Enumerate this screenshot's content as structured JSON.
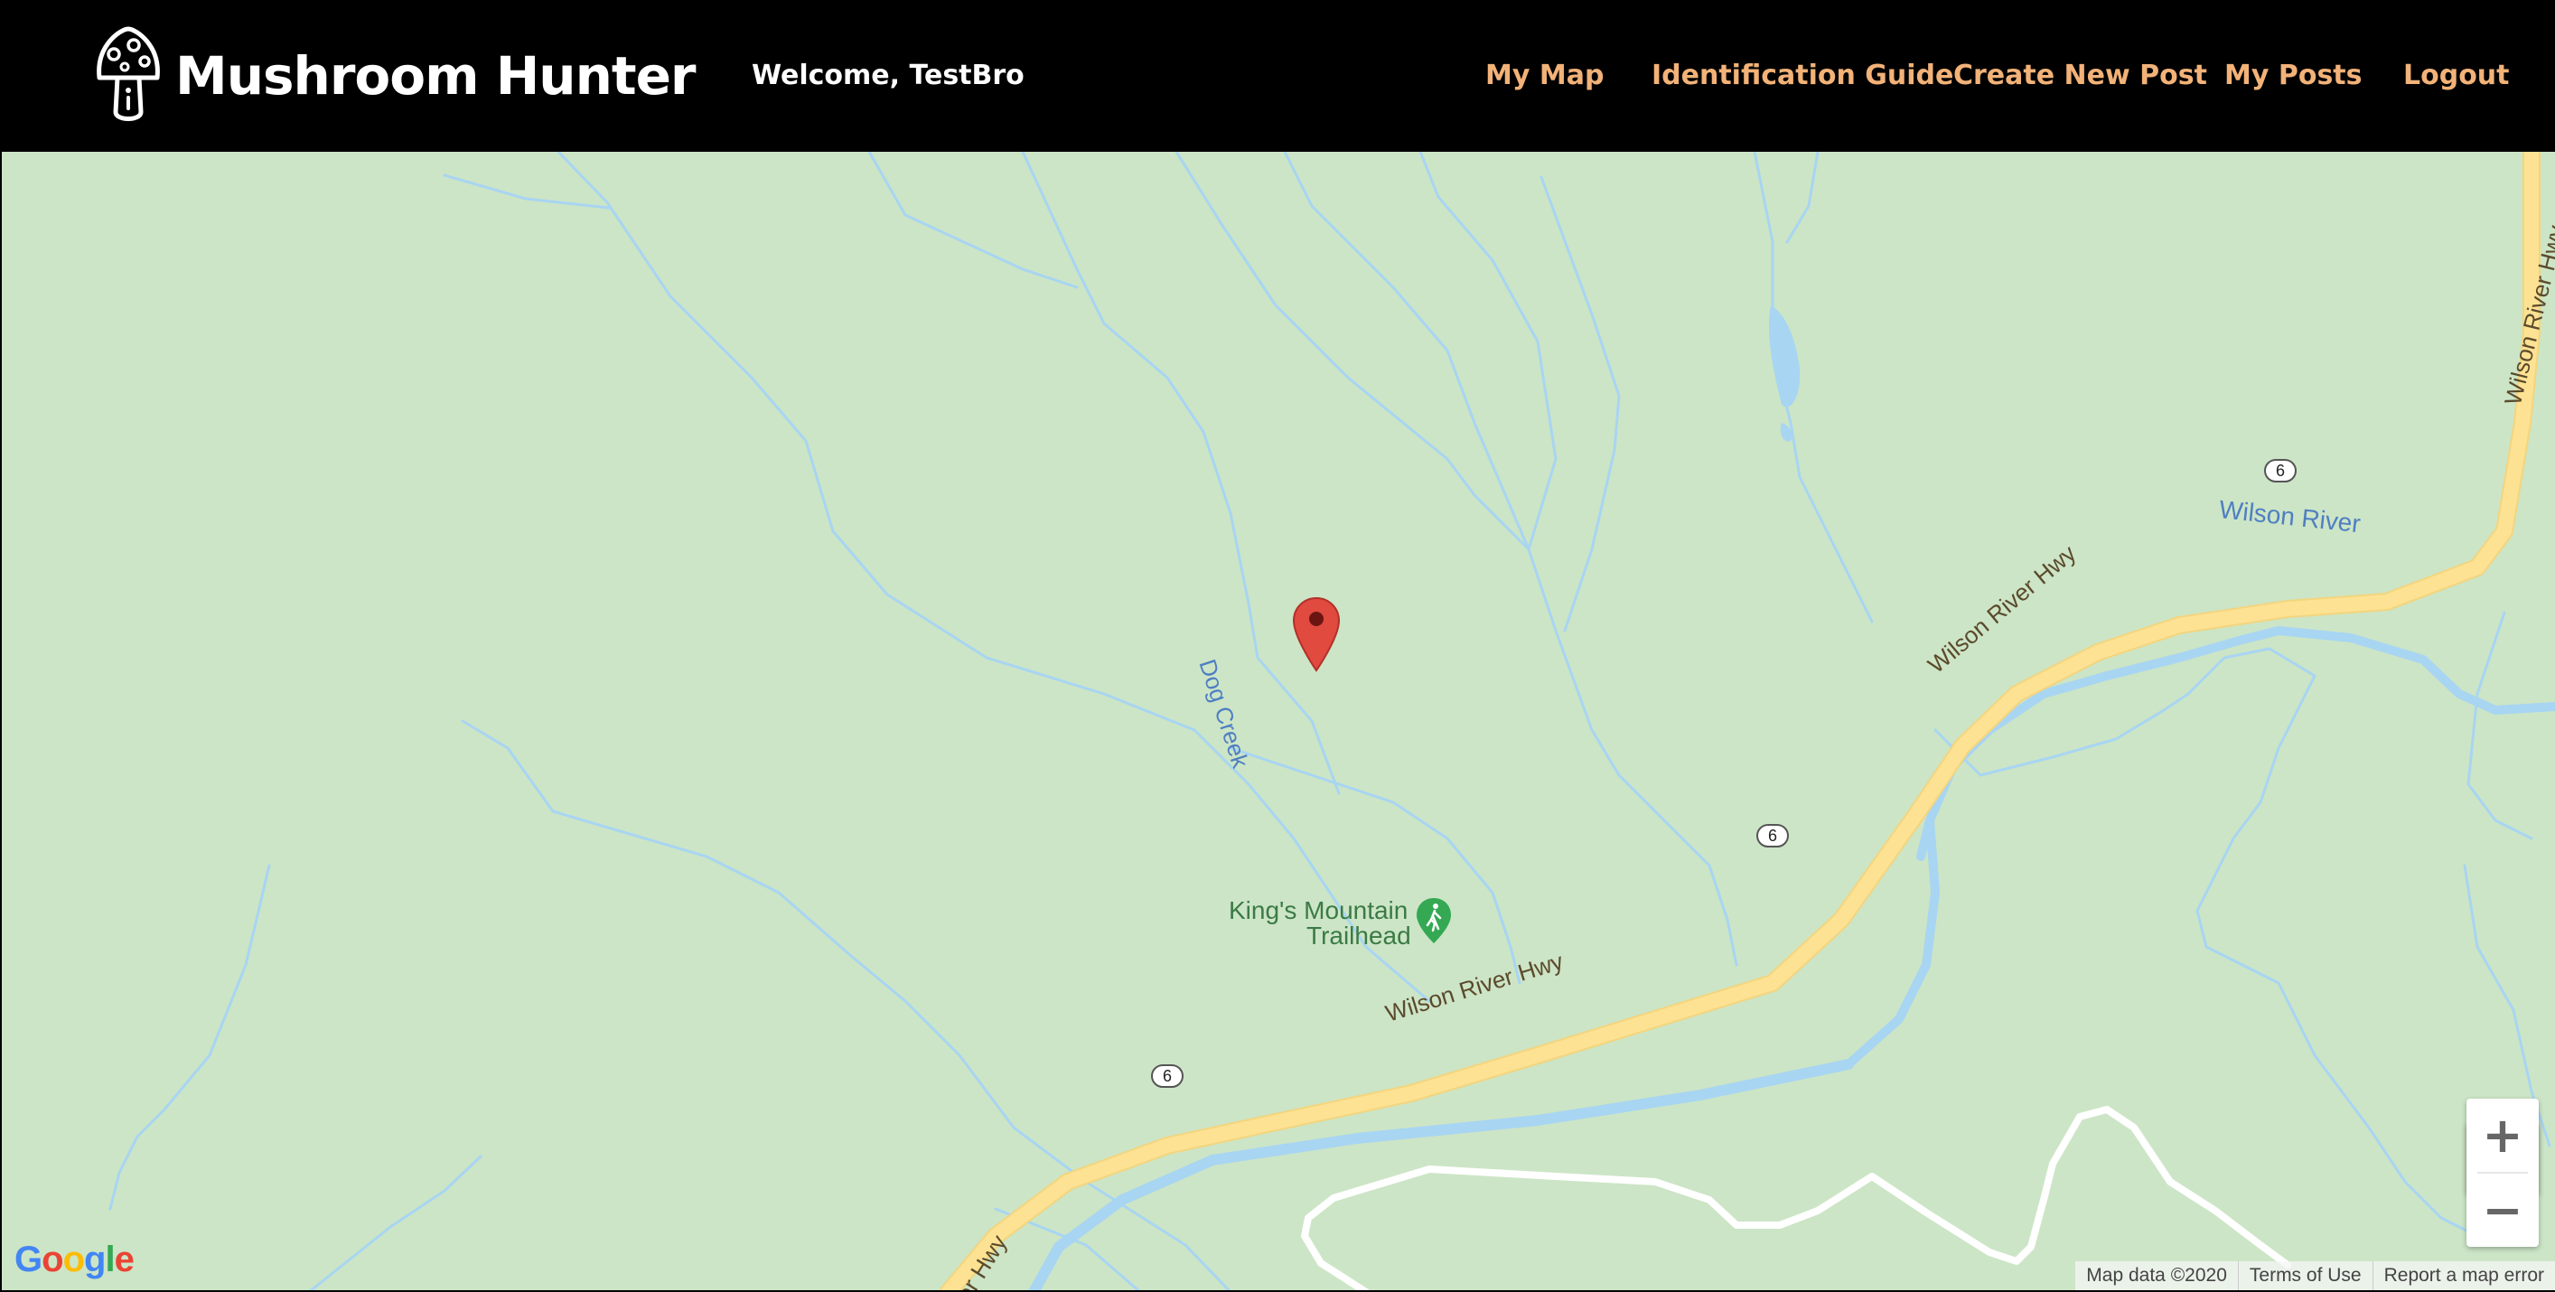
{
  "brand": {
    "title": "Mushroom Hunter",
    "logo_icon": "mushroom-icon"
  },
  "header": {
    "welcome": "Welcome, TestBro"
  },
  "nav": {
    "items": [
      "My Map",
      "Identification Guide",
      "Create New Post",
      "My Posts",
      "Logout"
    ],
    "color": "#f2b278"
  },
  "map": {
    "labels": {
      "dog_creek": "Dog Creek",
      "wilson_river": "Wilson River",
      "trailhead_line1": "King's Mountain",
      "trailhead_line2": "Trailhead",
      "hwy_top": "Wilson River Hwy",
      "hwy_mid": "Wilson River Hwy",
      "hwy_low": "Wilson River Hwy",
      "hwy_bottom": "er Hwy",
      "route_shield": "6"
    },
    "controls": {
      "zoom_in": "+",
      "zoom_out": "−",
      "pegman_icon": "pegman-icon"
    },
    "attribution": {
      "logo": "Google",
      "map_data": "Map data ©2020",
      "terms": "Terms of Use",
      "report": "Report a map error"
    },
    "colors": {
      "land": "#cce5c6",
      "water": "#a8d5f2",
      "highway": "#fde293",
      "marker": "#db4437"
    }
  }
}
